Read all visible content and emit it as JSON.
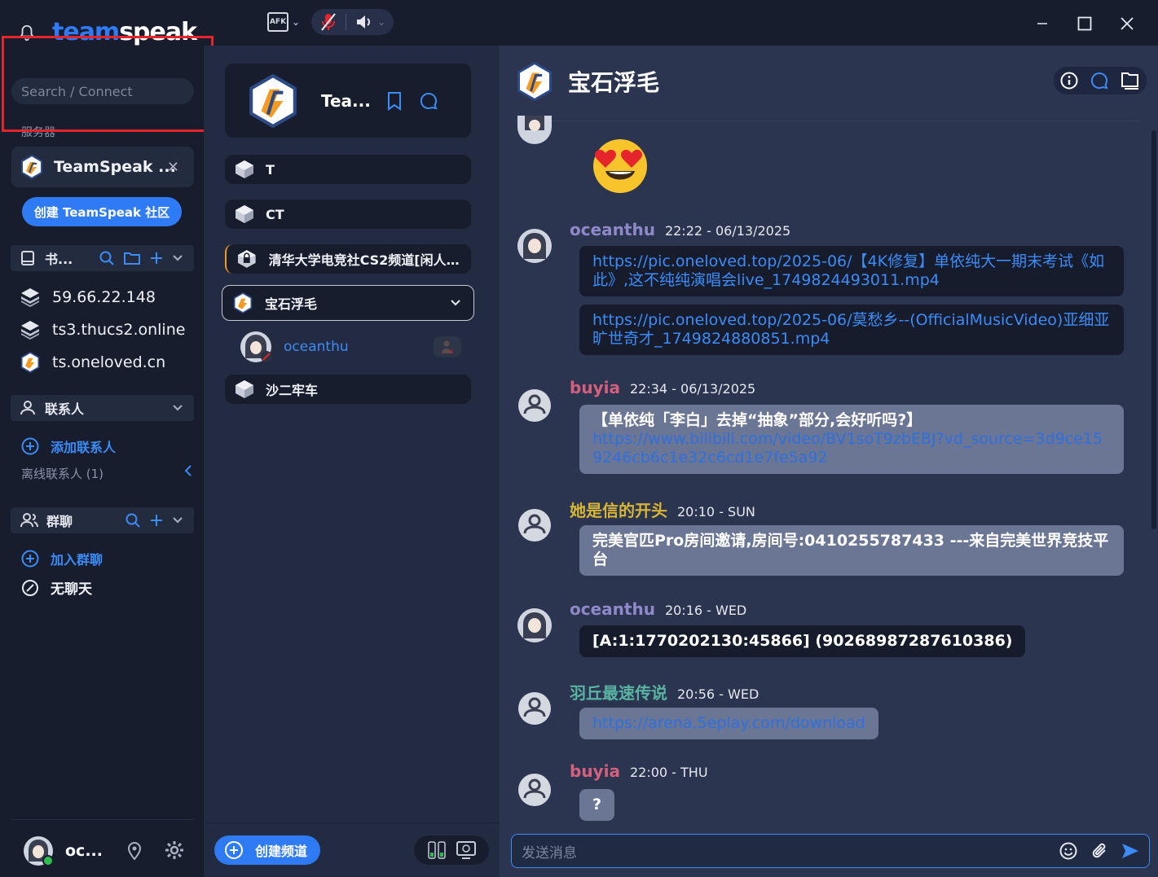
{
  "titlebar": {
    "brand_part1": "team",
    "brand_part2": "speak",
    "afk_label": "AFK"
  },
  "sidebar": {
    "search_placeholder": "Search / Connect",
    "servers_label": "服务器",
    "active_server": "TeamSpeak ...",
    "create_community": "创建 TeamSpeak 社区",
    "bookmarks_header": "书...",
    "bookmarks": [
      {
        "label": "59.66.22.148",
        "icon": "layers-icon"
      },
      {
        "label": "ts3.thucs2.online",
        "icon": "layers-icon"
      },
      {
        "label": "ts.oneloved.cn",
        "icon": "teamspeak-logo-icon"
      }
    ],
    "contacts_header": "联系人",
    "add_contact": "添加联系人",
    "offline_contacts": "离线联系人 (1)",
    "groups_header": "群聊",
    "join_group": "加入群聊",
    "no_chat": "无聊天",
    "user_name": "oc..."
  },
  "channels": {
    "server_title": "Tea...",
    "list": [
      {
        "label": "T"
      },
      {
        "label": "CT"
      },
      {
        "label": "清华大学电竞社CS2频道[闲人勿..."
      },
      {
        "label": "宝石浮毛"
      },
      {
        "label": "沙二牢车"
      }
    ],
    "occupant": "oceanthu",
    "create_channel": "创建频道"
  },
  "chat": {
    "title": "宝石浮毛",
    "messages": [
      {
        "author": "oceanthu",
        "time": "22:22 - 06/13/2025",
        "color": "#8f89c9",
        "bubbles": [
          "https://pic.oneloved.top/2025-06/【4K修复】单依纯大一期末考试《如此》,这不纯纯演唱会live_1749824493011.mp4",
          "https://pic.oneloved.top/2025-06/莫愁乡--(OfficialMusicVideo)亚细亚旷世奇才_1749824880851.mp4"
        ]
      },
      {
        "author": "buyia",
        "time": "22:34 - 06/13/2025",
        "color": "#d4607d",
        "title": "【单依纯「李白」去掉“抽象”部分,会好听吗?】",
        "link": "https://www.bilibili.com/video/BV1soT9zbEBJ?vd_source=3d9ce159246cb6c1e32c6cd1e7fe5a92"
      },
      {
        "author": "她是信的开头",
        "time": "20:10 - SUN",
        "color": "#d6b534",
        "text": "完美官匹Pro房间邀请,房间号:0410255787433 ---来自完美世界竞技平台"
      },
      {
        "author": "oceanthu",
        "time": "20:16 - WED",
        "color": "#8f89c9",
        "text": "[A:1:1770202130:45866] (90268987287610386)"
      },
      {
        "author": "羽丘最速传说",
        "time": "20:56 - WED",
        "color": "#58b3a3",
        "link": "https://arena.5eplay.com/download"
      },
      {
        "author": "buyia",
        "time": "22:00 - THU",
        "color": "#d4607d",
        "text": "?"
      }
    ],
    "compose_placeholder": "发送消息"
  },
  "colors": {
    "accent": "#2f7bf5",
    "annotation": "#e5242b"
  }
}
